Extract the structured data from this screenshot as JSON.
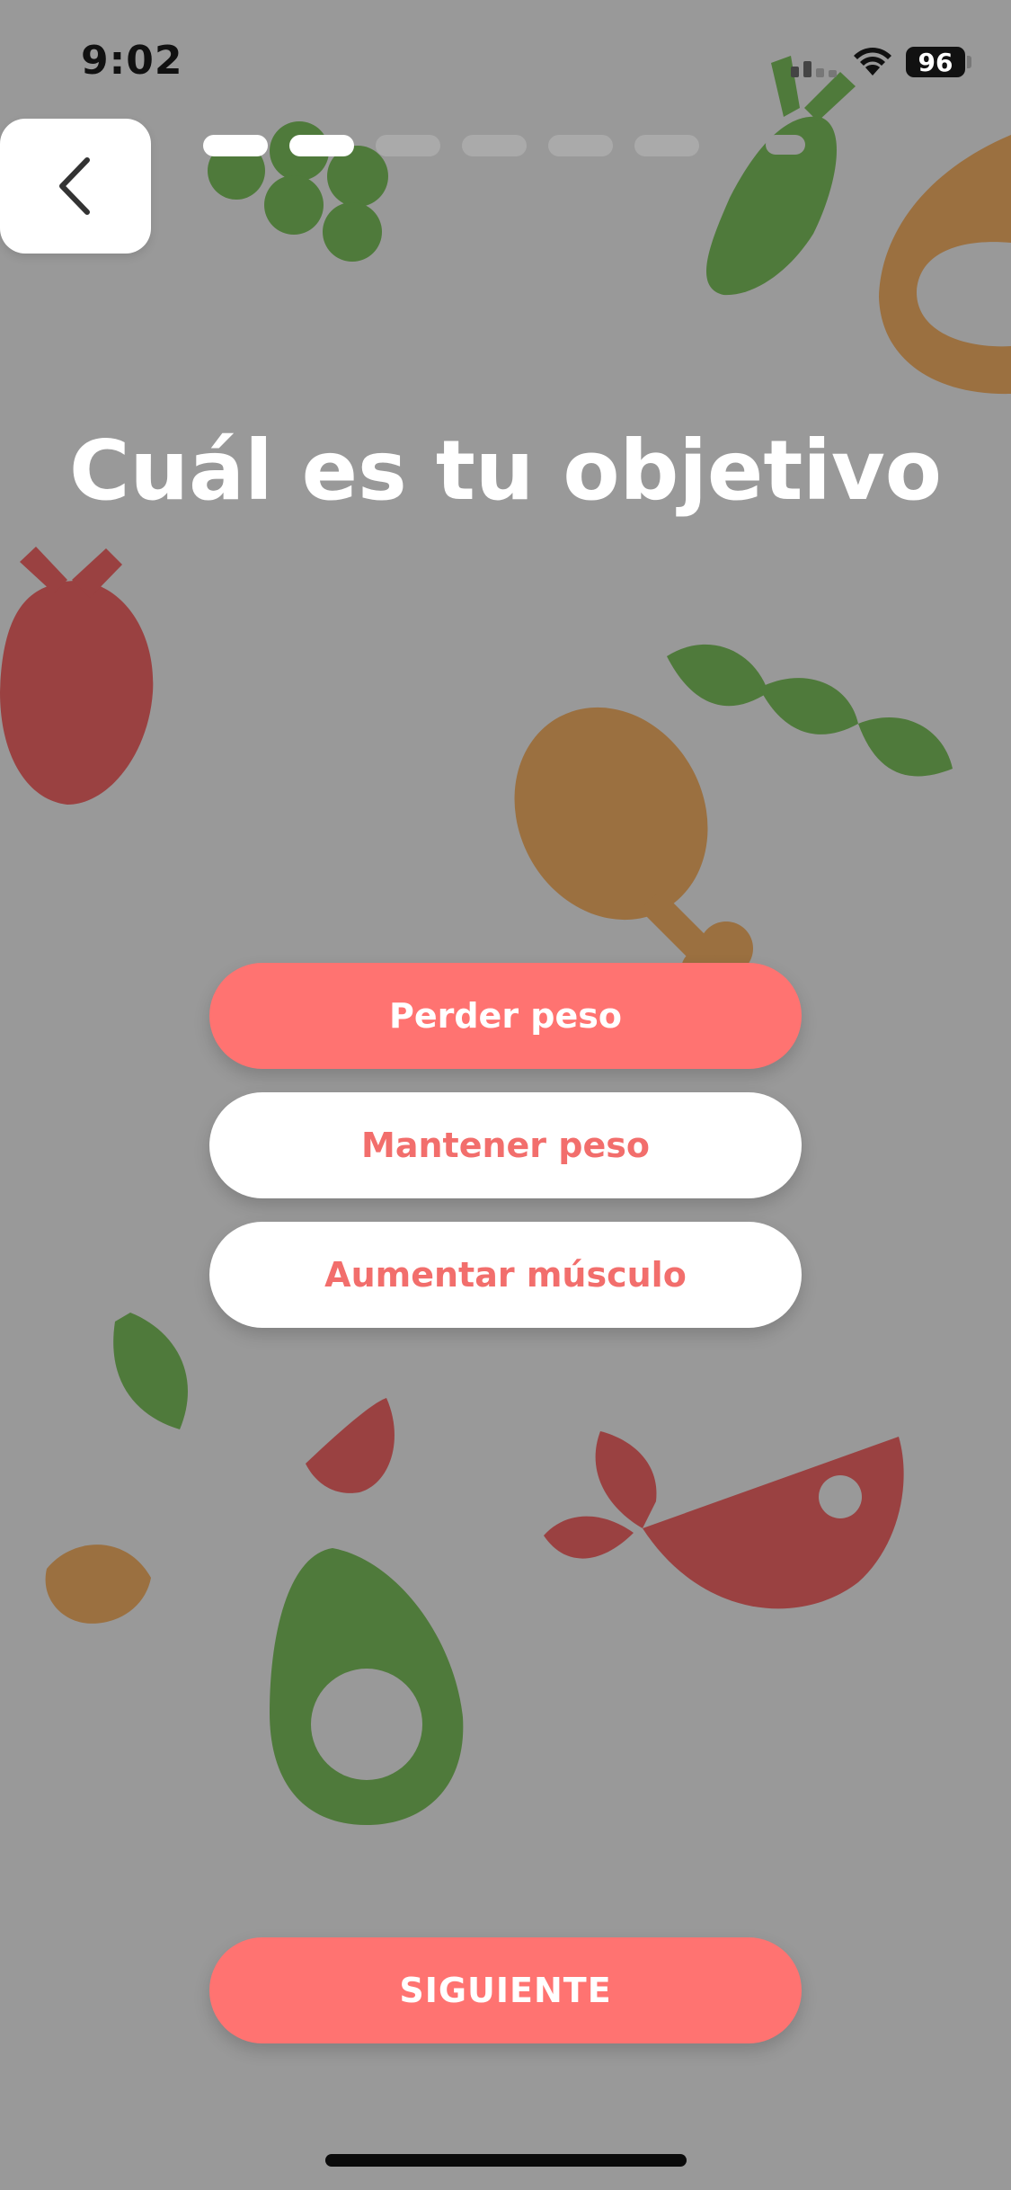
{
  "status_bar": {
    "time": "9:02",
    "battery": "96"
  },
  "header": {
    "back_icon": "chevron-left-icon",
    "progress": {
      "current_step": 2,
      "total_steps": 6
    }
  },
  "title": "Cuál es tu objetivo",
  "options": [
    {
      "label": "Perder peso",
      "selected": true
    },
    {
      "label": "Mantener peso",
      "selected": false
    },
    {
      "label": "Aumentar músculo",
      "selected": false
    }
  ],
  "next_label": "SIGUIENTE",
  "colors": {
    "background": "#999999",
    "accent": "#ff7371",
    "food_green": "#4f7a3b",
    "food_brown": "#9b7040",
    "food_red": "#9a4141"
  }
}
